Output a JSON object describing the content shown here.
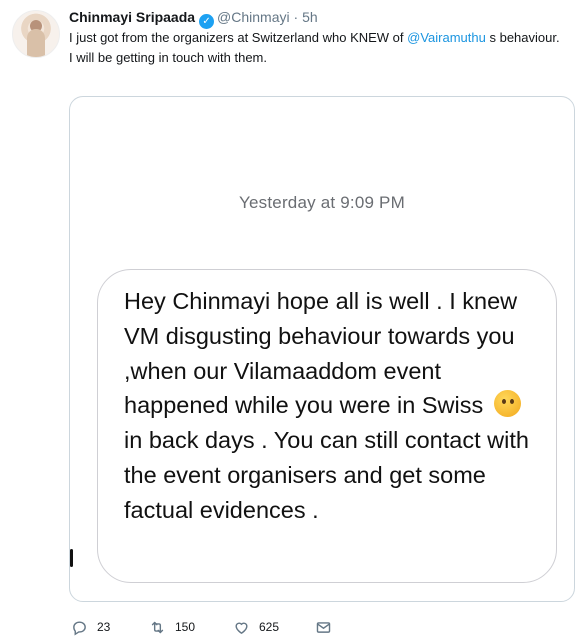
{
  "tweet": {
    "author": {
      "display_name": "Chinmayi Sripaada",
      "handle": "@Chinmayi",
      "separator": "·",
      "time_ago": "5h",
      "verified": true
    },
    "text": {
      "part1": "I just got from the organizers at Switzerland who KNEW of ",
      "mention": "@Vairamuthu",
      "part2": " s behaviour.",
      "line2": "I will be getting in touch with them."
    },
    "media": {
      "timestamp": "Yesterday at 9:09 PM",
      "message": {
        "before_emoji": "Hey Chinmayi hope all is well . I knew VM disgusting behaviour towards you ,when our Vilamaaddom event happened while you were in Swiss",
        "emoji": "thinking-face-icon",
        "after_emoji": "in back days . You can still contact with the event organisers and get some factual evidences ."
      }
    },
    "actions": {
      "replies": "23",
      "retweets": "150",
      "likes": "625"
    }
  },
  "colors": {
    "accent": "#1da1f2",
    "link": "#1b95e0",
    "muted": "#657786",
    "border": "#ccd6dd"
  }
}
